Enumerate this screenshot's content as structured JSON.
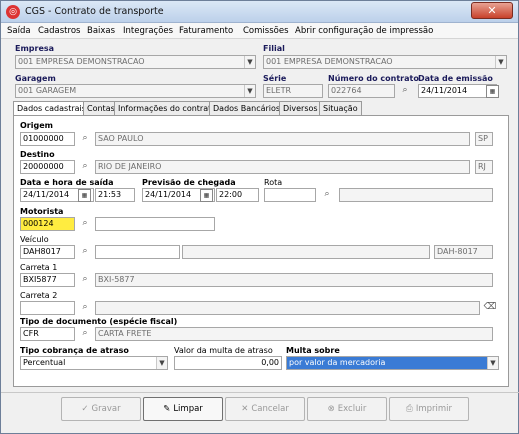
{
  "window": {
    "title": "CGS - Contrato de transporte",
    "close_glyph": "✕"
  },
  "menu": [
    "Saída",
    "Cadastros",
    "Baixas",
    "Integrações",
    "Faturamento",
    "Comissões",
    "Abrir configuração de impressão"
  ],
  "header": {
    "empresa_label": "Empresa",
    "empresa_value": "001 EMPRESA DEMONSTRACAO",
    "filial_label": "Filial",
    "filial_value": "001 EMPRESA DEMONSTRACAO",
    "garagem_label": "Garagem",
    "garagem_value": "001 GARAGEM",
    "serie_label": "Série",
    "serie_value": "ELETR",
    "numero_label": "Número do contrato",
    "numero_value": "022764",
    "emissao_label": "Data de emissão",
    "emissao_value": "24/11/2014"
  },
  "tabs": [
    "Dados cadastrais",
    "Contas",
    "Informações do contrato",
    "Dados Bancários",
    "Diversos",
    "Situação"
  ],
  "form": {
    "origem_label": "Origem",
    "origem_code": "01000000",
    "origem_name": "SAO PAULO",
    "origem_uf": "SP",
    "destino_label": "Destino",
    "destino_code": "20000000",
    "destino_name": "RIO DE JANEIRO",
    "destino_uf": "RJ",
    "saida_label": "Data e hora de saída",
    "saida_date": "24/11/2014",
    "saida_time": "21:53",
    "chegada_label": "Previsão de chegada",
    "chegada_date": "24/11/2014",
    "chegada_time": "22:00",
    "rota_label": "Rota",
    "motorista_label": "Motorista",
    "motorista_code": "000124",
    "veiculo_label": "Veículo",
    "veiculo_code": "DAH8017",
    "veiculo_plate": "DAH-8017",
    "carreta1_label": "Carreta 1",
    "carreta1_code": "BXI5877",
    "carreta1_name": "BXI-5877",
    "carreta2_label": "Carreta 2",
    "tipodoc_label": "Tipo de documento (espécie fiscal)",
    "tipodoc_code": "CFR",
    "tipodoc_name": "CARTA FRETE",
    "cobranca_label": "Tipo cobrança de atraso",
    "cobranca_value": "Percentual",
    "multa_label": "Valor da multa de atraso",
    "multa_value": "0,00",
    "multa_sobre_label": "Multa sobre",
    "multa_sobre_value": "por valor da mercadoria"
  },
  "buttons": {
    "gravar": "Gravar",
    "limpar": "Limpar",
    "cancelar": "Cancelar",
    "excluir": "Excluir",
    "imprimir": "Imprimir"
  },
  "icons": [
    "app-icon",
    "close-icon",
    "binoculars-icon",
    "calendar-icon",
    "dropdown-arrow-icon",
    "checkmark-icon",
    "broom-icon",
    "cancel-x-icon",
    "delete-icon",
    "printer-icon",
    "eraser-icon"
  ]
}
